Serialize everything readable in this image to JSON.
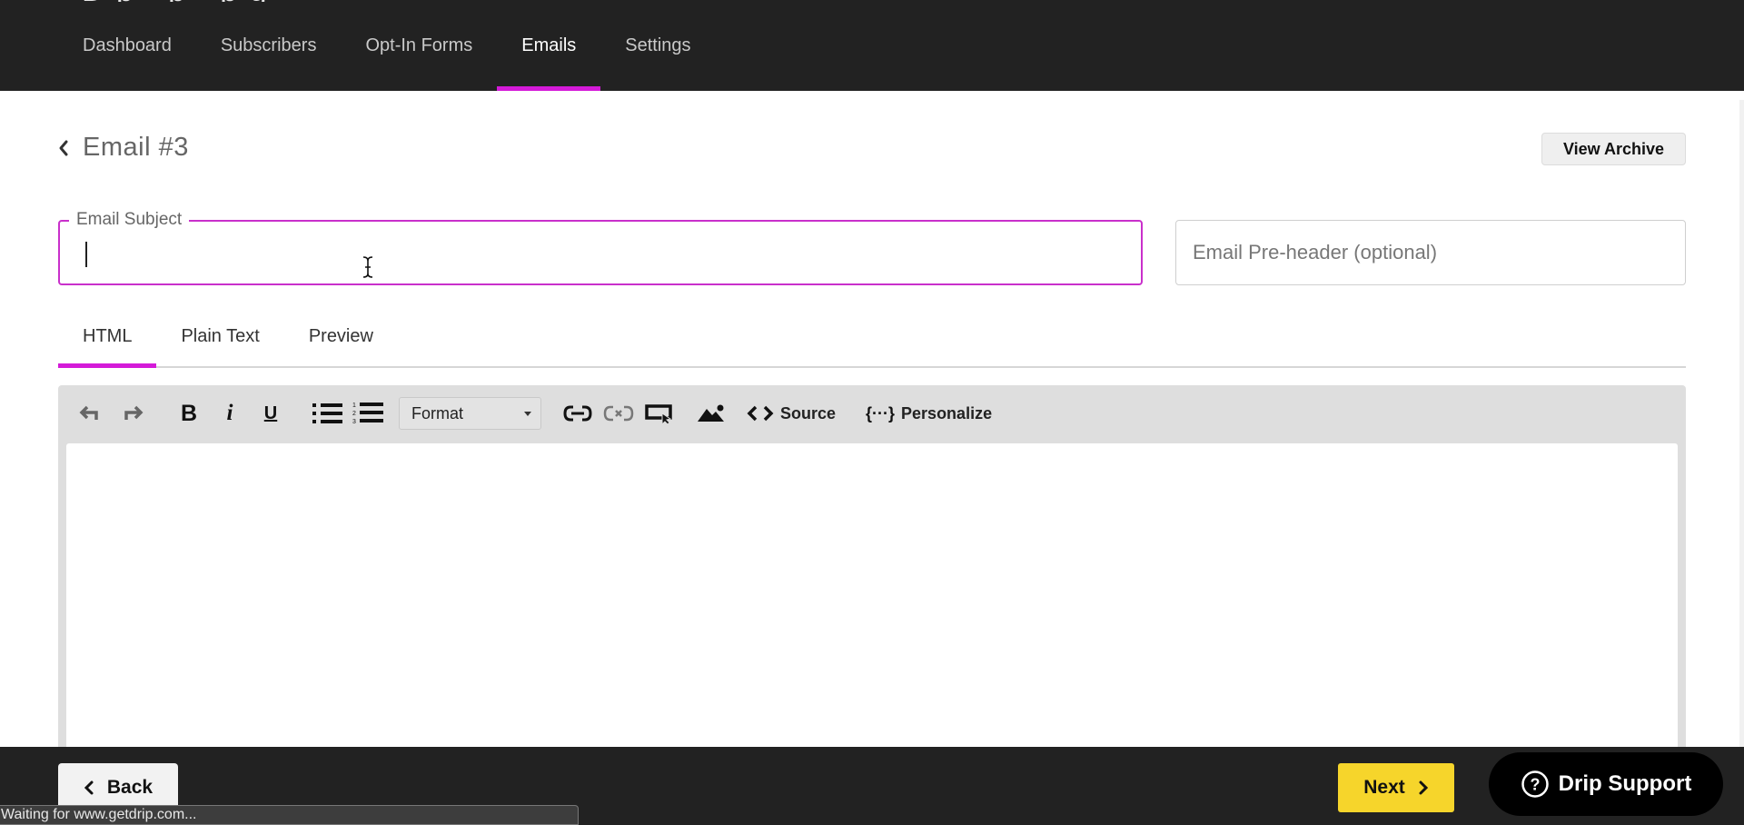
{
  "top_nav": {
    "cut_title": "D  p    ·    p  ·  p  g",
    "items": [
      {
        "label": "Dashboard",
        "active": false
      },
      {
        "label": "Subscribers",
        "active": false
      },
      {
        "label": "Opt-In Forms",
        "active": false
      },
      {
        "label": "Emails",
        "active": true
      },
      {
        "label": "Settings",
        "active": false
      }
    ]
  },
  "header": {
    "title": "Email #3",
    "view_archive_label": "View Archive"
  },
  "form": {
    "subject_label": "Email Subject",
    "subject_value": "",
    "preheader_placeholder": "Email Pre-header (optional)",
    "preheader_value": ""
  },
  "tabs": [
    {
      "label": "HTML",
      "active": true
    },
    {
      "label": "Plain Text",
      "active": false
    },
    {
      "label": "Preview",
      "active": false
    }
  ],
  "toolbar": {
    "format_selected": "Format",
    "source_label": "Source",
    "personalize_label": "Personalize",
    "icons": [
      "undo-icon",
      "redo-icon",
      "bold-icon",
      "italic-icon",
      "underline-icon",
      "bulleted-list-icon",
      "numbered-list-icon",
      "link-icon",
      "unlink-icon",
      "button-link-icon",
      "image-icon",
      "source-code-icon",
      "personalize-icon"
    ]
  },
  "editor": {
    "content": ""
  },
  "footer": {
    "back_label": "Back",
    "next_label": "Next",
    "support_label": "Drip Support"
  },
  "status_bar": {
    "text": "Waiting for www.getdrip.com..."
  },
  "colors": {
    "accent": "#d41ad8",
    "next_button": "#f6d52b",
    "nav_bg": "#222222"
  }
}
